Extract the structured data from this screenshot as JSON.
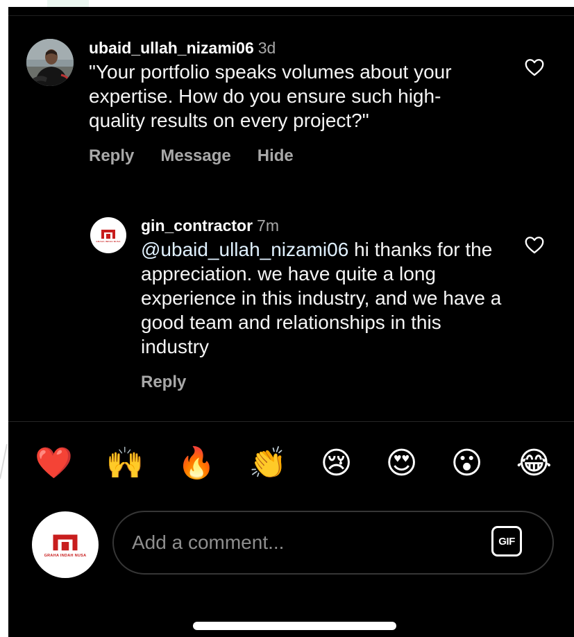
{
  "comment": {
    "username": "ubaid_ullah_nizami06",
    "time": "3d",
    "text": "\"Your portfolio speaks volumes about your expertise. How do you ensure such high-quality results on every project?\"",
    "actions": {
      "reply": "Reply",
      "message": "Message",
      "hide": "Hide"
    }
  },
  "reply": {
    "username": "gin_contractor",
    "time": "7m",
    "mention": "@ubaid_ullah_nizami06",
    "text": " hi thanks for the appreciation. we have quite a long experience in this industry, and we have a good team and relationships in this industry",
    "actions": {
      "reply": "Reply"
    }
  },
  "brand": {
    "logo_text": "GRAHA INDAH NUSA",
    "logo_color": "#c81e1e"
  },
  "emoji_bar": [
    {
      "name": "red-heart",
      "glyph": "❤️"
    },
    {
      "name": "raising-hands",
      "glyph": "🙌"
    },
    {
      "name": "fire",
      "glyph": "🔥"
    },
    {
      "name": "clapping-hands",
      "glyph": "👏"
    },
    {
      "name": "crying-face",
      "glyph": "😢"
    },
    {
      "name": "heart-eyes",
      "glyph": "😍"
    },
    {
      "name": "surprised-face",
      "glyph": "😮"
    },
    {
      "name": "tears-of-joy",
      "glyph": "😂"
    }
  ],
  "composer": {
    "placeholder": "Add a comment...",
    "gif_label": "GIF"
  },
  "icons": {
    "like": "heart-outline-icon",
    "gif": "gif-icon"
  },
  "colors": {
    "background": "#000000",
    "text": "#ffffff",
    "muted": "#a8a8a8",
    "mention": "#e0f1ff",
    "divider": "#262626"
  }
}
